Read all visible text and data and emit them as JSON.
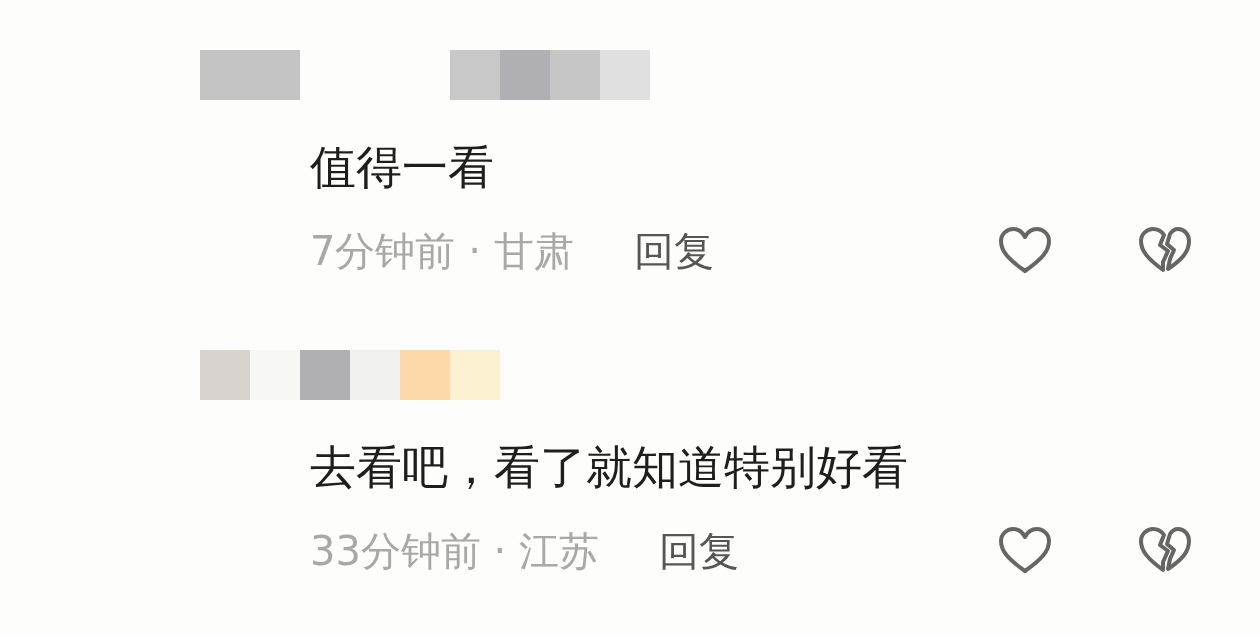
{
  "comments": [
    {
      "text": "值得一看",
      "meta": "7分钟前 · 甘肃",
      "reply": "回复"
    },
    {
      "text": "去看吧，看了就知道特别好看",
      "meta": "33分钟前 · 江苏",
      "reply": "回复"
    }
  ]
}
